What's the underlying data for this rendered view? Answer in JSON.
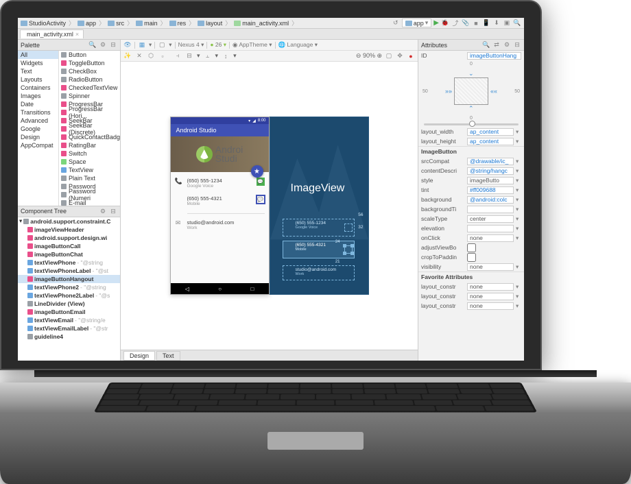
{
  "breadcrumb": {
    "project": "StudioActivity",
    "path": [
      "app",
      "src",
      "main",
      "res",
      "layout"
    ],
    "file": "main_activity.xml",
    "run_config": "app"
  },
  "editor_tab": "main_activity.xml",
  "palette": {
    "title": "Palette",
    "categories": [
      "All",
      "Widgets",
      "Text",
      "Layouts",
      "Containers",
      "Images",
      "Date",
      "Transitions",
      "Advanced",
      "Google",
      "Design",
      "AppCompat"
    ],
    "selected_category": "All",
    "items": [
      {
        "icon": "#9aa0a6",
        "label": "Button"
      },
      {
        "icon": "#e94f8a",
        "label": "ToggleButton"
      },
      {
        "icon": "#9aa0a6",
        "label": "CheckBox"
      },
      {
        "icon": "#9aa0a6",
        "label": "RadioButton"
      },
      {
        "icon": "#e94f8a",
        "label": "CheckedTextView"
      },
      {
        "icon": "#9aa0a6",
        "label": "Spinner"
      },
      {
        "icon": "#e94f8a",
        "label": "ProgressBar"
      },
      {
        "icon": "#e94f8a",
        "label": "ProgressBar (Hori..."
      },
      {
        "icon": "#e94f8a",
        "label": "SeekBar"
      },
      {
        "icon": "#e94f8a",
        "label": "SeekBar (Discrete)"
      },
      {
        "icon": "#e94f8a",
        "label": "QuickContactBadg"
      },
      {
        "icon": "#e94f8a",
        "label": "RatingBar"
      },
      {
        "icon": "#e94f8a",
        "label": "Switch"
      },
      {
        "icon": "#7cd67c",
        "label": "Space"
      },
      {
        "icon": "#6aa6e0",
        "label": "TextView"
      },
      {
        "icon": "#9aa0a6",
        "label": "Plain Text"
      },
      {
        "icon": "#9aa0a6",
        "label": "Password"
      },
      {
        "icon": "#9aa0a6",
        "label": "Password (Numeri"
      },
      {
        "icon": "#9aa0a6",
        "label": "E-mail"
      }
    ]
  },
  "tree": {
    "title": "Component Tree",
    "root": "android.support.constraint.C",
    "nodes": [
      {
        "icon": "#e94f8a",
        "label": "imageViewHeader",
        "indent": 1
      },
      {
        "icon": "#e94f8a",
        "label": "android.support.design.wi",
        "indent": 1
      },
      {
        "icon": "#e94f8a",
        "label": "imageButtonCall",
        "indent": 1
      },
      {
        "icon": "#e94f8a",
        "label": "imageButtonChat",
        "indent": 1
      },
      {
        "icon": "#6aa6e0",
        "label": "textViewPhone",
        "val": "- \"@string",
        "indent": 1
      },
      {
        "icon": "#6aa6e0",
        "label": "textViewPhoneLabel",
        "val": "- \"@st",
        "indent": 1
      },
      {
        "icon": "#e94f8a",
        "label": "imageButtonHangout",
        "indent": 1,
        "sel": true
      },
      {
        "icon": "#6aa6e0",
        "label": "textViewPhone2",
        "val": "- \"@string",
        "indent": 1
      },
      {
        "icon": "#6aa6e0",
        "label": "textViewPhone2Label",
        "val": "- \"@s",
        "indent": 1
      },
      {
        "icon": "#9aa0a6",
        "label": "LineDivider (View)",
        "indent": 1
      },
      {
        "icon": "#e94f8a",
        "label": "imageButtonEmail",
        "indent": 1
      },
      {
        "icon": "#6aa6e0",
        "label": "textViewEmail",
        "val": "- \"@string/e",
        "indent": 1
      },
      {
        "icon": "#6aa6e0",
        "label": "textViewEmailLabel",
        "val": "- \"@str",
        "indent": 1
      },
      {
        "icon": "#9aa0a6",
        "label": "guideline4",
        "indent": 1
      }
    ]
  },
  "design_toolbar": {
    "device": "Nexus 4",
    "api": "26",
    "theme": "AppTheme",
    "lang": "Language",
    "zoom": "90%"
  },
  "preview": {
    "time": "8:00",
    "appbar_title": "Android Studio",
    "header_text": "Androi\nStudio",
    "contacts": [
      {
        "icon": "📞",
        "line1": "(650) 555-1234",
        "line2": "Google Voice",
        "action": "chat"
      },
      {
        "icon": "",
        "line1": "(650) 555-4321",
        "line2": "Mobile",
        "action": "chat",
        "selected": true
      },
      {
        "icon": "✉",
        "line1": "studio@android.com",
        "line2": "Work",
        "action": ""
      }
    ],
    "blueprint_label": "ImageView",
    "blueprint_overlays": [
      {
        "text": "(650) 555-1234",
        "sub": "Google Voice"
      },
      {
        "text": "(650) 555-4321",
        "sub": "Mobile"
      },
      {
        "text": "studio@android.com",
        "sub": "Work"
      }
    ],
    "bp_measure_top": "56",
    "bp_measure_side": "32",
    "bp_measure_inner": "24",
    "bp_measure_inner2": "21"
  },
  "attributes": {
    "title": "Attributes",
    "id_value": "imageButtonHang",
    "margin_h": "50",
    "margin_v": "0",
    "rows": [
      {
        "label": "layout_width",
        "val": "ap_content",
        "link": true
      },
      {
        "label": "layout_height",
        "val": "ap_content",
        "link": true
      }
    ],
    "section": "ImageButton",
    "rows2": [
      {
        "label": "srcCompat",
        "val": "@drawable/ic_",
        "link": true
      },
      {
        "label": "contentDescri",
        "val": "@string/hangc",
        "link": true
      },
      {
        "label": "style",
        "val": "imageButto",
        "plain": true
      },
      {
        "label": "tint",
        "val": "#ff009688",
        "link": true
      },
      {
        "label": "background",
        "val": "@android:colc",
        "link": true
      },
      {
        "label": "backgroundTi",
        "val": "",
        "plain": true
      },
      {
        "label": "scaleType",
        "val": "center",
        "plain": true
      },
      {
        "label": "elevation",
        "val": "",
        "plain": true
      },
      {
        "label": "onClick",
        "val": "none",
        "plain": true
      },
      {
        "label": "adjustViewBo",
        "val": "",
        "check": true
      },
      {
        "label": "cropToPaddin",
        "val": "",
        "check": true
      },
      {
        "label": "visibility",
        "val": "none",
        "plain": true
      }
    ],
    "fav": "Favorite Attributes",
    "rows3": [
      {
        "label": "layout_constr",
        "val": "none",
        "plain": true
      },
      {
        "label": "layout_constr",
        "val": "none",
        "plain": true
      },
      {
        "label": "layout_constr",
        "val": "none",
        "plain": true
      }
    ]
  },
  "bottom": {
    "design": "Design",
    "text": "Text"
  }
}
